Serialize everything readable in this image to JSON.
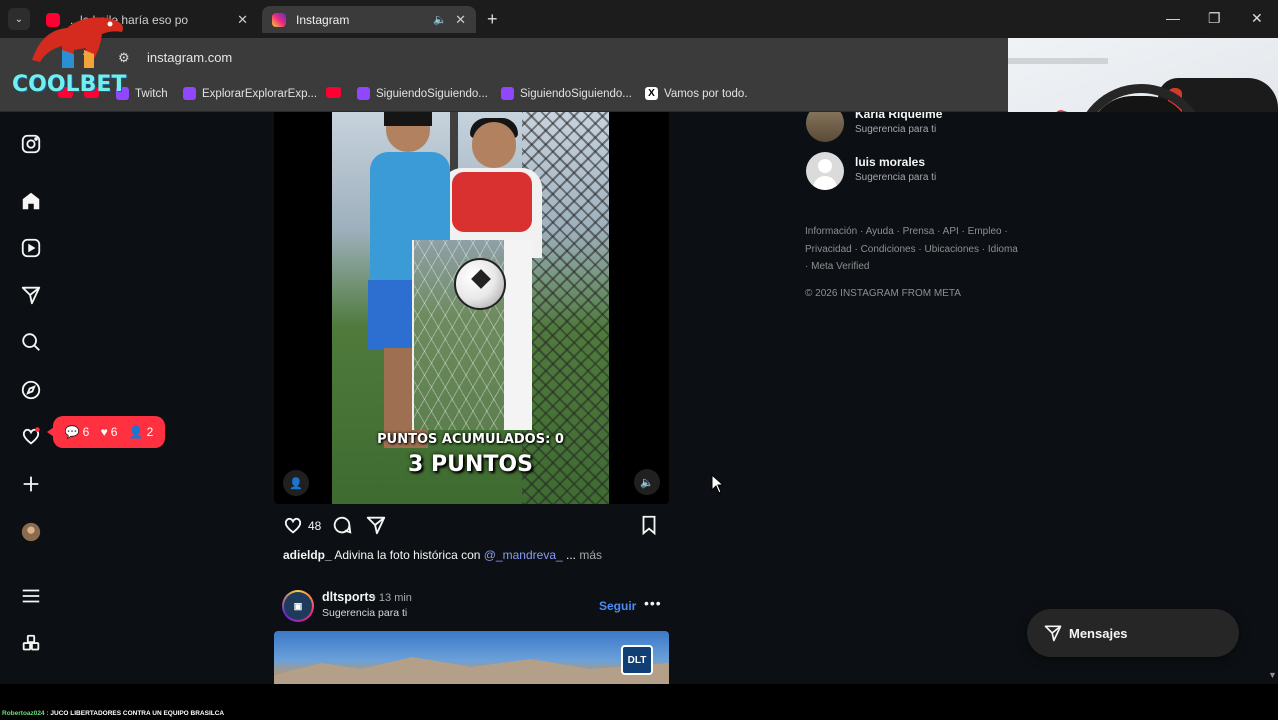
{
  "browser": {
    "tabs": [
      {
        "title": "...le baile haría eso po",
        "active": false
      },
      {
        "title": "Instagram",
        "active": true
      }
    ],
    "new_tab": "+",
    "url": "instagram.com",
    "window_controls": [
      "—",
      "❐",
      "✕"
    ],
    "bookmarks": [
      {
        "label": "",
        "icon": "youtube-icon"
      },
      {
        "label": "Twitch",
        "icon": "twitch-icon"
      },
      {
        "label": "ExplorarExplorarExp...",
        "icon": "twitch-icon"
      },
      {
        "label": "",
        "icon": "youtube-icon"
      },
      {
        "label": "SiguiendoSiguiendo...",
        "icon": "twitch-icon"
      },
      {
        "label": "SiguiendoSiguiendo...",
        "icon": "twitch-icon"
      },
      {
        "label": "Vamos por todo.",
        "icon": "x-icon"
      }
    ]
  },
  "overlay": {
    "logo_text": "COOLBET"
  },
  "sidebar": {
    "items": [
      "instagram-logo-icon",
      "home-icon",
      "reels-icon",
      "direct-icon",
      "search-icon",
      "explore-icon",
      "notifications-icon",
      "create-icon",
      "profile-avatar",
      "menu-icon",
      "more-apps-icon"
    ],
    "notifications": {
      "comments": "6",
      "likes": "6",
      "follows": "2"
    }
  },
  "post1": {
    "video_text_line1": "PUNTOS ACUMULADOS: 0",
    "video_text_line2": "3 PUNTOS",
    "likes": "48",
    "caption_user": "adieldp_",
    "caption_text": " Adivina la foto histórica con ",
    "caption_mention": "@_mandreva_",
    "caption_more_sep": " ... ",
    "caption_more": "más"
  },
  "post2": {
    "username": "dltsports",
    "time": "• 13 min",
    "subtitle": "Sugerencia para ti",
    "follow": "Seguir",
    "more": "•••",
    "badge": "DLT"
  },
  "suggestions": [
    {
      "name": "Karla Riquelme",
      "subtitle": "Sugerencia para ti"
    },
    {
      "name": "luis morales",
      "subtitle": "Sugerencia para ti"
    }
  ],
  "footer": {
    "links": "Información · Ayuda · Prensa · API · Empleo · Privacidad · Condiciones · Ubicaciones · Idioma · Meta Verified",
    "copyright": "© 2026 INSTAGRAM FROM META"
  },
  "messages": {
    "label": "Mensajes"
  },
  "ticker": {
    "user": "Robertoaz024 :",
    "text": " JUCO LIBERTADORES CONTRA UN EQUIPO BRASILCA"
  },
  "colors": {
    "ig_bg": "#0c1014",
    "notif_red": "#ff3040",
    "link_blue": "#4a8cf7"
  }
}
